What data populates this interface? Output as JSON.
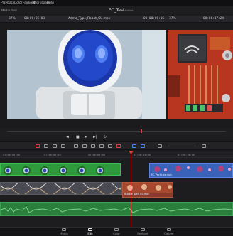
{
  "menu": [
    "Playback",
    "Color",
    "Fairlight",
    "Workspace",
    "Help"
  ],
  "window": {
    "title": "EC_Test",
    "status": "Edited",
    "media_pool": "Media Pool"
  },
  "viewer_left": {
    "zoom": "37%",
    "timecode_in": "00:00:05:03",
    "clip_name": "Admo_Type_Robot_CU.mov",
    "timecode_out": "00:00:00:16"
  },
  "viewer_right": {
    "zoom": "37%",
    "timecode": "00:00:17:24"
  },
  "transport": {
    "prev_label": "◄",
    "stop_label": "■",
    "play_label": "►",
    "next_label": "►|",
    "loop_label": "↻"
  },
  "ruler": {
    "ticks": [
      "01:00:00:00",
      "01:00:04:16",
      "01:00:09:08",
      "01:00:14:00",
      "01:00:18:16"
    ]
  },
  "timeline": {
    "clips": [
      {
        "label": "Robot_Lift_GS.mov"
      },
      {
        "label": "EC_Particles.mov"
      },
      {
        "label": "Bubble_Wall_ES.mov"
      }
    ]
  },
  "pages": [
    {
      "label": "Media",
      "icon": "media-icon"
    },
    {
      "label": "Edit",
      "icon": "edit-icon"
    },
    {
      "label": "Color",
      "icon": "color-icon"
    },
    {
      "label": "Fairlight",
      "icon": "fairlight-icon"
    },
    {
      "label": "Deliver",
      "icon": "deliver-icon"
    }
  ],
  "colors": {
    "accent_red": "#e3423c",
    "clip_green": "#2e9a3c",
    "clip_blue": "#3a62b8",
    "audio_green": "#2b7f3c"
  }
}
